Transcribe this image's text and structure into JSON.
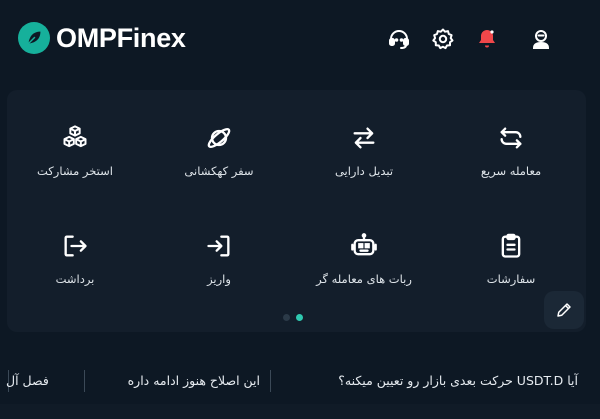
{
  "header": {
    "brand": "OMPFinex",
    "icons": [
      "support-icon",
      "settings-icon",
      "notification-icon",
      "profile-icon"
    ],
    "colors": {
      "accent": "#2fc9b0",
      "notification": "#f0474a",
      "background": "#0d1824"
    }
  },
  "shortcuts": [
    {
      "label": "معامله سریع",
      "icon": "quick-trade-icon"
    },
    {
      "label": "تبدیل دارایی",
      "icon": "convert-icon"
    },
    {
      "label": "سفر کهکشانی",
      "icon": "planet-icon"
    },
    {
      "label": "استخر مشارکت",
      "icon": "cubes-icon"
    },
    {
      "label": "سفارشات",
      "icon": "clipboard-icon"
    },
    {
      "label": "ربات های معامله گر",
      "icon": "robot-icon"
    },
    {
      "label": "واریز",
      "icon": "deposit-icon"
    },
    {
      "label": "برداشت",
      "icon": "withdraw-icon"
    }
  ],
  "pager": {
    "current": 1,
    "total": 2
  },
  "news": [
    {
      "text": "آیا USDT.D حرکت بعدی بازار رو تعیین میکنه؟"
    },
    {
      "text": "این اصلاح هنوز ادامه داره"
    },
    {
      "text": "فصل آل"
    }
  ]
}
